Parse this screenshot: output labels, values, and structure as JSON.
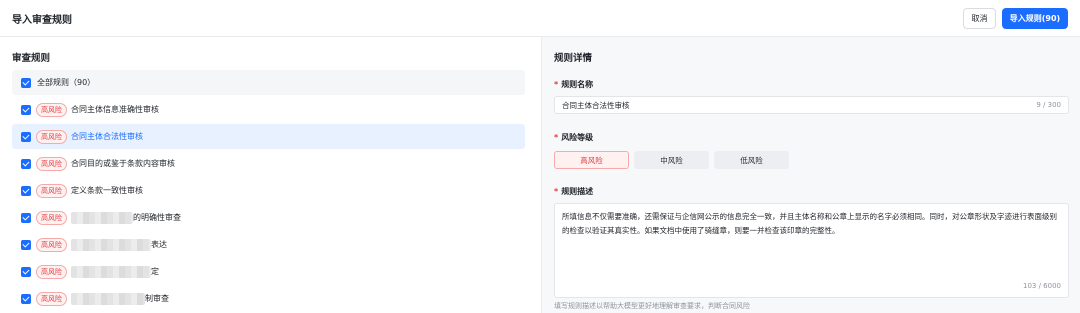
{
  "header": {
    "title": "导入审查规则",
    "cancel_label": "取消",
    "import_label": "导入规则(90)"
  },
  "rules_panel": {
    "title": "审查规则",
    "all_label": "全部规则（90）",
    "items": [
      {
        "tag": "高风险",
        "name": "合同主体信息准确性审核",
        "blurred": false
      },
      {
        "tag": "高风险",
        "name": "合同主体合法性审核",
        "blurred": false,
        "selected": true
      },
      {
        "tag": "高风险",
        "name": "合同目的或鉴于条款内容审核",
        "blurred": false
      },
      {
        "tag": "高风险",
        "name": "定义条款一致性审核",
        "blurred": false
      },
      {
        "tag": "高风险",
        "name": "的明确性审查",
        "blurred": true
      },
      {
        "tag": "高风险",
        "name": "表达",
        "blurred": true
      },
      {
        "tag": "高风险",
        "name": "定",
        "blurred": true
      },
      {
        "tag": "高风险",
        "name": "制审查",
        "blurred": true
      }
    ]
  },
  "detail_panel": {
    "title": "规则详情",
    "name_label": "规则名称",
    "name_value": "合同主体合法性审核",
    "name_count": "9 / 300",
    "level_label": "风险等级",
    "levels": [
      "高风险",
      "中风险",
      "低风险"
    ],
    "active_level": "高风险",
    "desc_label": "规则描述",
    "desc_value": "所填信息不仅需要准确，还需保证与企信网公示的信息完全一致，并且主体名称和公章上显示的名字必须相同。同时，对公章形状及字迹进行表面级别的检查以验证其真实性。如果文档中使用了骑缝章，则要一并检查该印章的完整性。",
    "desc_count": "103 / 6000",
    "hint": "填写规则描述以帮助大模型更好地理解审查要求，判断合同风险"
  },
  "colors": {
    "primary": "#1a6dff",
    "risk_high": "#e0393e",
    "risk_high_bg": "#fff1f0"
  }
}
